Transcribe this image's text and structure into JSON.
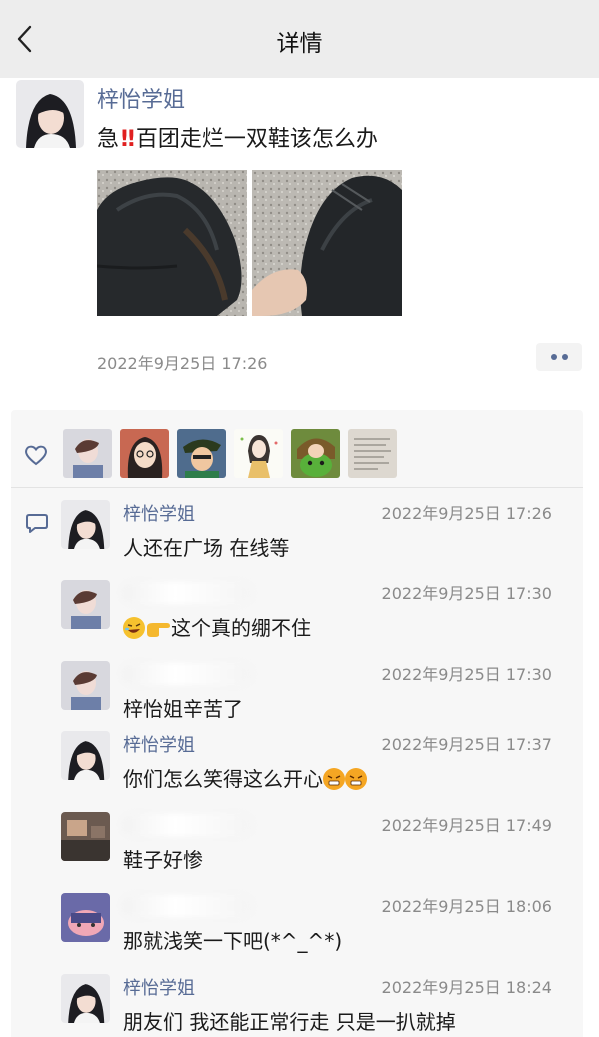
{
  "header": {
    "title": "详情"
  },
  "post": {
    "author": "梓怡学姐",
    "text_prefix": "急",
    "text_bang": "‼",
    "text_suffix": "百团走烂一双鞋该怎么办",
    "photos": [
      "shoe-photo-1",
      "shoe-photo-2"
    ],
    "time": "2022年9月25日 17:26"
  },
  "likes": {
    "count": 6
  },
  "comments": [
    {
      "author": "梓怡学姐",
      "time": "2022年9月25日 17:26",
      "text": "人还在广场 在线等"
    },
    {
      "author": "",
      "time": "2022年9月25日 17:30",
      "text": "这个真的绷不住"
    },
    {
      "author": "",
      "time": "2022年9月25日 17:30",
      "text": "梓怡姐辛苦了"
    },
    {
      "author": "梓怡学姐",
      "time": "2022年9月25日 17:37",
      "text": "你们怎么笑得这么开心"
    },
    {
      "author": "",
      "time": "2022年9月25日 17:49",
      "text": "鞋子好惨"
    },
    {
      "author": "",
      "time": "2022年9月25日 18:06",
      "text": "那就浅笑一下吧(*^_^*)"
    },
    {
      "author": "梓怡学姐",
      "time": "2022年9月25日 18:24",
      "text": "朋友们 我还能正常行走 只是一扒就掉"
    }
  ],
  "colors": {
    "header_bg": "#ededed",
    "link": "#576b95",
    "meta": "#8a8a8a",
    "panel_bg": "#f7f7f7"
  }
}
